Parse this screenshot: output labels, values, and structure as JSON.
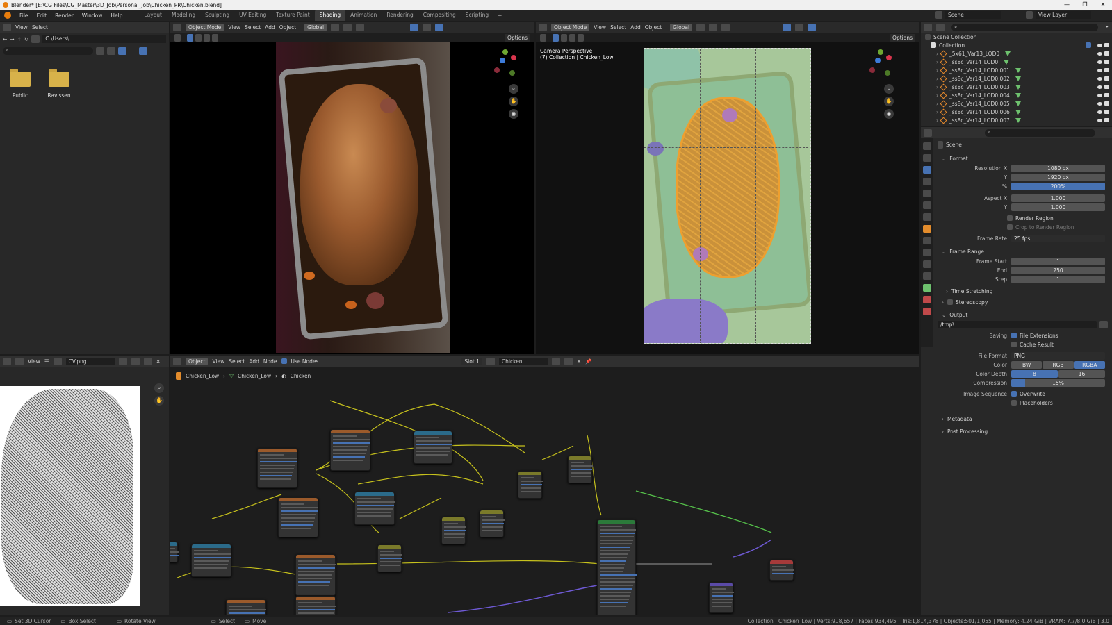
{
  "window": {
    "title": "Blender* [E:\\CG Files\\CG_Master\\3D_Job\\Personal_Job\\Chicken_PR\\Chicken.blend]"
  },
  "menu": [
    "File",
    "Edit",
    "Render",
    "Window",
    "Help"
  ],
  "workspaces": [
    {
      "label": "Layout",
      "active": false
    },
    {
      "label": "Modeling",
      "active": false
    },
    {
      "label": "Sculpting",
      "active": false
    },
    {
      "label": "UV Editing",
      "active": false
    },
    {
      "label": "Texture Paint",
      "active": false
    },
    {
      "label": "Shading",
      "active": true
    },
    {
      "label": "Animation",
      "active": false
    },
    {
      "label": "Rendering",
      "active": false
    },
    {
      "label": "Compositing",
      "active": false
    },
    {
      "label": "Scripting",
      "active": false
    }
  ],
  "top_right": {
    "scene": "Scene",
    "view_layer": "View Layer"
  },
  "file_browser": {
    "view": "View",
    "select": "Select",
    "path": "C:\\Users\\",
    "items": [
      {
        "label": "Public"
      },
      {
        "label": "Ravissen"
      }
    ]
  },
  "viewport_left": {
    "mode": "Object Mode",
    "view": "View",
    "select": "Select",
    "add": "Add",
    "object": "Object",
    "orientation": "Global",
    "options": "Options"
  },
  "viewport_right": {
    "mode": "Object Mode",
    "view": "View",
    "select": "Select",
    "add": "Add",
    "object": "Object",
    "orientation": "Global",
    "options": "Options",
    "overlay_line1": "Camera Perspective",
    "overlay_line2": "(7) Collection | Chicken_Low"
  },
  "outliner": {
    "root": "Scene Collection",
    "collection": "Collection",
    "objects": [
      "_5x61_Var13_LOD0",
      "_ss8c_Var14_LOD0",
      "_ss8c_Var14_LOD0.001",
      "_ss8c_Var14_LOD0.002",
      "_ss8c_Var14_LOD0.003",
      "_ss8c_Var14_LOD0.004",
      "_ss8c_Var14_LOD0.005",
      "_ss8c_Var14_LOD0.006",
      "_ss8c_Var14_LOD0.007"
    ]
  },
  "properties": {
    "scene": "Scene",
    "format": {
      "title": "Format",
      "res_x_label": "Resolution X",
      "res_x": "1080 px",
      "res_y_label": "Y",
      "res_y": "1920 px",
      "pct_label": "%",
      "pct": "200%",
      "aspect_x_label": "Aspect X",
      "aspect_x": "1.000",
      "aspect_y_label": "Y",
      "aspect_y": "1.000",
      "render_region": "Render Region",
      "crop": "Crop to Render Region",
      "frame_rate_label": "Frame Rate",
      "frame_rate": "25 fps"
    },
    "frame_range": {
      "title": "Frame Range",
      "start_label": "Frame Start",
      "start": "1",
      "end_label": "End",
      "end": "250",
      "step_label": "Step",
      "step": "1",
      "time_stretching": "Time Stretching"
    },
    "stereoscopy": "Stereoscopy",
    "output": {
      "title": "Output",
      "path": "/tmp\\",
      "saving_label": "Saving",
      "file_ext": "File Extensions",
      "cache": "Cache Result",
      "file_format_label": "File Format",
      "file_format": "PNG",
      "color_label": "Color",
      "color_bw": "BW",
      "color_rgb": "RGB",
      "color_rgba": "RGBA",
      "depth_label": "Color Depth",
      "depth_8": "8",
      "depth_16": "16",
      "compression_label": "Compression",
      "compression": "15%",
      "compression_value": 0.15,
      "seq_label": "Image Sequence",
      "overwrite": "Overwrite",
      "placeholders": "Placeholders"
    },
    "metadata": "Metadata",
    "post": "Post Processing"
  },
  "image_editor": {
    "view": "View",
    "image_name": "CV.png"
  },
  "node_editor": {
    "object": "Object",
    "view": "View",
    "select": "Select",
    "add": "Add",
    "node": "Node",
    "use_nodes": "Use Nodes",
    "slot": "Slot 1",
    "material": "Chicken",
    "breadcrumb": [
      "Chicken_Low",
      "Chicken_Low",
      "Chicken"
    ]
  },
  "statusbar": {
    "set_cursor": "Set 3D Cursor",
    "box_select": "Box Select",
    "rotate": "Rotate View",
    "select": "Select",
    "move": "Move",
    "stats": "Collection | Chicken_Low | Verts:918,657 | Faces:934,495 | Tris:1,814,378 | Objects:501/1,055 | Memory: 4.24 GiB | VRAM: 7.7/8.0 GiB | 3.0"
  },
  "colors": {
    "accent": "#4772b3",
    "orange": "#e38c2c",
    "header": "#303030"
  }
}
